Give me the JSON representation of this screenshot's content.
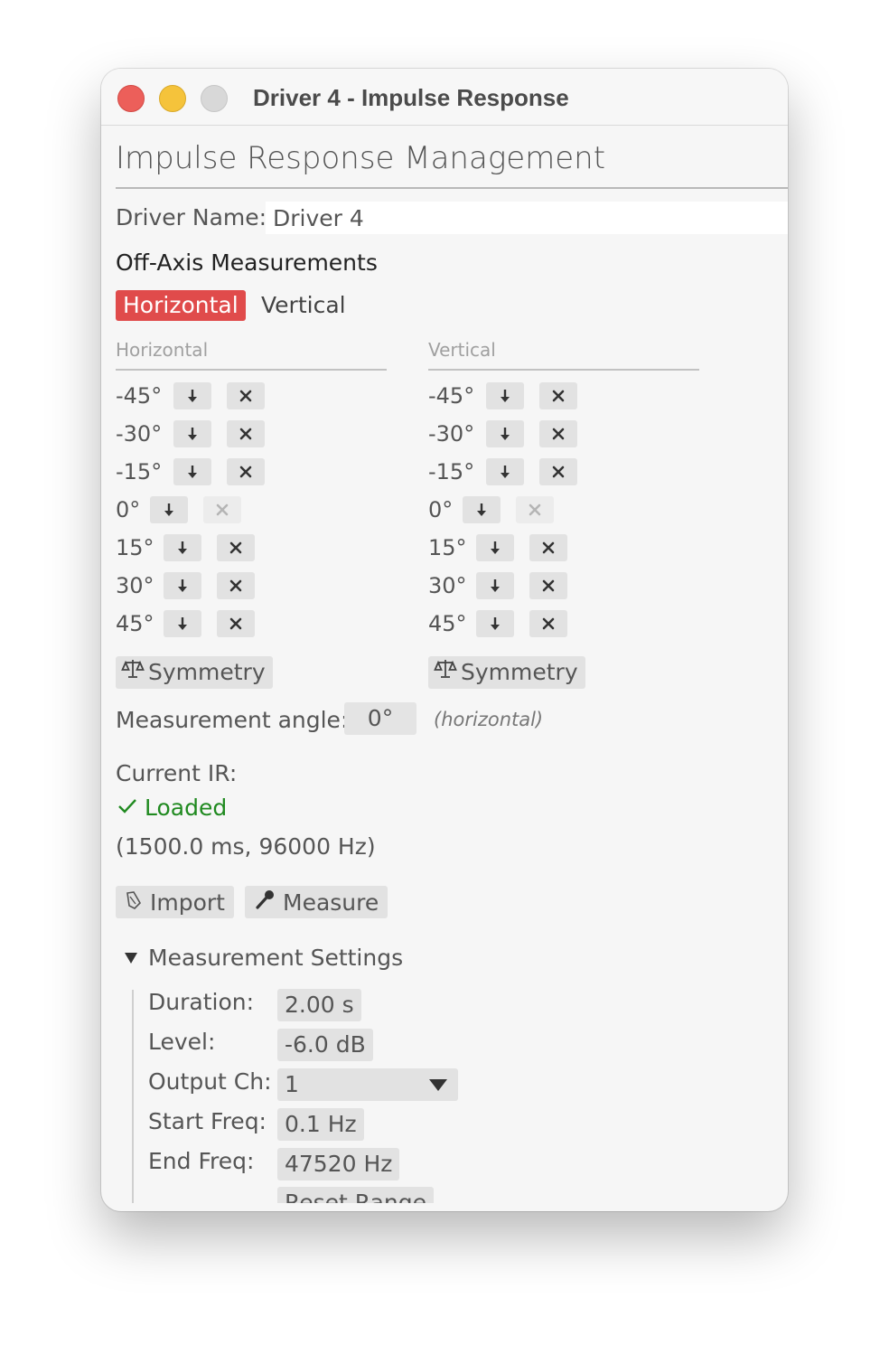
{
  "window": {
    "title": "Driver 4 - Impulse Response"
  },
  "page": {
    "heading": "Impulse Response Management"
  },
  "driver": {
    "name_label": "Driver Name:",
    "name_value": "Driver 4"
  },
  "offaxis": {
    "title": "Off-Axis Measurements",
    "tabs": [
      {
        "label": "Horizontal",
        "active": true
      },
      {
        "label": "Vertical",
        "active": false
      }
    ],
    "columns": [
      {
        "title": "Horizontal",
        "rows": [
          {
            "angle": "-45°",
            "delete_enabled": true
          },
          {
            "angle": "-30°",
            "delete_enabled": true
          },
          {
            "angle": "-15°",
            "delete_enabled": true
          },
          {
            "angle": "0°",
            "delete_enabled": false
          },
          {
            "angle": "15°",
            "delete_enabled": true
          },
          {
            "angle": "30°",
            "delete_enabled": true
          },
          {
            "angle": "45°",
            "delete_enabled": true
          }
        ],
        "symmetry_label": "Symmetry"
      },
      {
        "title": "Vertical",
        "rows": [
          {
            "angle": "-45°",
            "delete_enabled": true
          },
          {
            "angle": "-30°",
            "delete_enabled": true
          },
          {
            "angle": "-15°",
            "delete_enabled": true
          },
          {
            "angle": "0°",
            "delete_enabled": false
          },
          {
            "angle": "15°",
            "delete_enabled": true
          },
          {
            "angle": "30°",
            "delete_enabled": true
          },
          {
            "angle": "45°",
            "delete_enabled": true
          }
        ],
        "symmetry_label": "Symmetry"
      }
    ]
  },
  "measurement_angle": {
    "label": "Measurement angle:",
    "value": "0°",
    "note": "(horizontal)"
  },
  "current_ir": {
    "label": "Current IR:",
    "status": "Loaded",
    "details": "(1500.0 ms, 96000 Hz)"
  },
  "actions": {
    "import_label": "Import",
    "measure_label": "Measure"
  },
  "settings": {
    "title": "Measurement Settings",
    "duration": {
      "label": "Duration:",
      "value": "2.00 s"
    },
    "level": {
      "label": "Level:",
      "value": "-6.0 dB"
    },
    "output_ch": {
      "label": "Output Ch:",
      "value": "1"
    },
    "start_freq": {
      "label": "Start Freq:",
      "value": "0.1 Hz"
    },
    "end_freq": {
      "label": "End Freq:",
      "value": "47520 Hz"
    },
    "reset_label": "Reset Range"
  },
  "colors": {
    "accent": "#e04b4b",
    "loaded": "#208a20",
    "button_bg": "#e2e2e2",
    "window_bg": "#f6f6f6"
  }
}
